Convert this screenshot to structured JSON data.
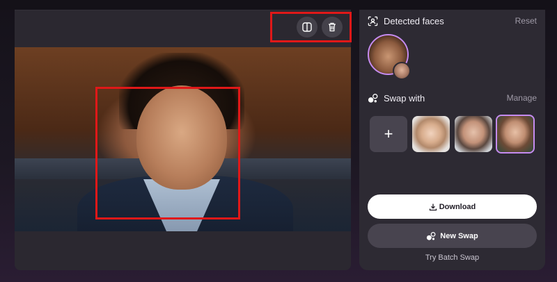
{
  "detected": {
    "title": "Detected faces",
    "reset_label": "Reset"
  },
  "swap": {
    "title": "Swap with",
    "manage_label": "Manage",
    "add_symbol": "+"
  },
  "actions": {
    "download_label": "Download",
    "new_swap_label": "New Swap",
    "batch_label": "Try Batch Swap"
  },
  "colors": {
    "accent": "#c58bf0",
    "highlight_frame": "#e01818"
  },
  "icons": {
    "compare": "split-view-icon",
    "delete": "trash-icon",
    "detected": "face-scan-icon",
    "swap": "swap-bubbles-icon",
    "download": "download-icon"
  }
}
